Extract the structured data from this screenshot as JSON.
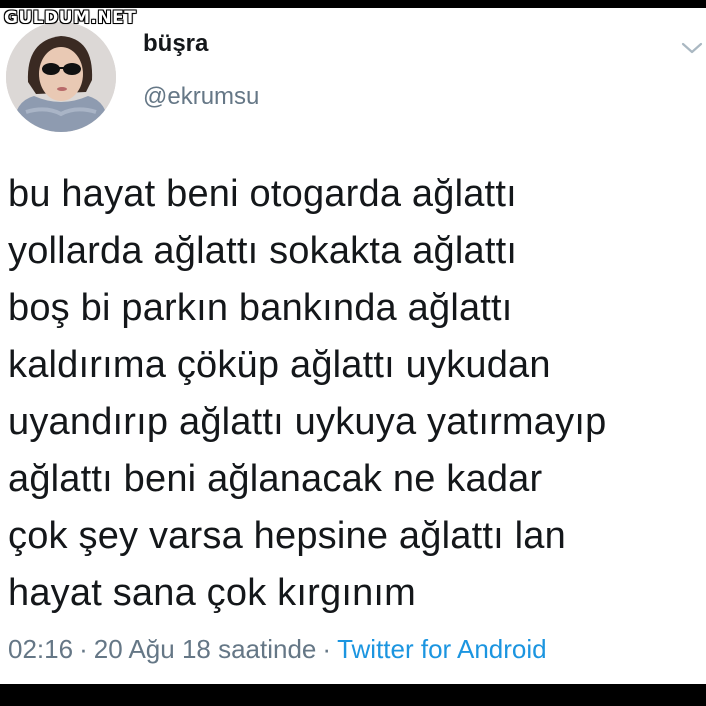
{
  "watermark": "GULDUM.NET",
  "user": {
    "name": "büşra",
    "handle": "@ekrumsu",
    "avatar_icon": "profile-photo"
  },
  "menu_icon": "chevron-down-icon",
  "tweet": {
    "lines": [
      "bu hayat beni otogarda ağlattı",
      "yollarda ağlattı sokakta ağlattı",
      "boş bi parkın bankında ağlattı",
      "kaldırıma çöküp ağlattı uykudan",
      "uyandırıp ağlattı uykuya yatırmayıp",
      "ağlattı beni ağlanacak ne kadar",
      "çok şey varsa hepsine ağlattı lan",
      "hayat sana çok kırgınım"
    ]
  },
  "meta": {
    "time": "02:16",
    "separator": "·",
    "date": "20 Ağu 18 saatinde",
    "source": "Twitter for Android"
  },
  "colors": {
    "text": "#14171a",
    "secondary": "#657786",
    "link": "#1b95e0",
    "background": "#ffffff",
    "border": "#000000"
  }
}
